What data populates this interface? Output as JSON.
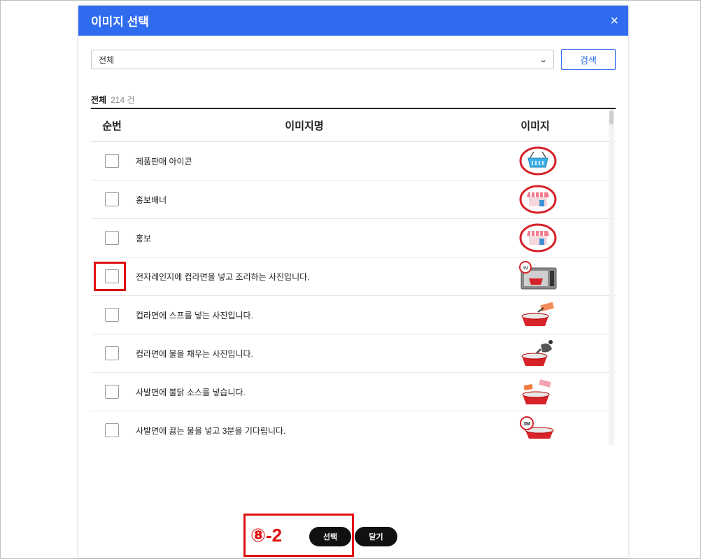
{
  "modal": {
    "title": "이미지 선택",
    "close_icon": "×"
  },
  "filter": {
    "selected": "전체",
    "search_label": "검색"
  },
  "count": {
    "label": "전체",
    "value": "214 건"
  },
  "table": {
    "headers": {
      "no": "순번",
      "name": "이미지명",
      "image": "이미지"
    },
    "rows": [
      {
        "name": "제품판매 아이콘",
        "image_icon": "shopping-basket"
      },
      {
        "name": "홍보배너",
        "image_icon": "storefront"
      },
      {
        "name": "홍보",
        "image_icon": "storefront"
      },
      {
        "name": "전자레인지에 컵라면을 넣고 조리하는 사진입니다.",
        "image_icon": "microwave-3m30s"
      },
      {
        "name": "컵라면에 스프를 넣는 사진입니다.",
        "image_icon": "cup-noodle-soup-packet"
      },
      {
        "name": "컵라면에 물을 채우는 사진입니다.",
        "image_icon": "cup-noodle-kettle"
      },
      {
        "name": "사발면에 불닭 소스를 넣습니다.",
        "image_icon": "bowl-noodle-sauce"
      },
      {
        "name": "사발면에 끓는 물을 넣고 3분을 기다립니다.",
        "image_icon": "bowl-noodle-3m"
      }
    ]
  },
  "footer": {
    "step_label": "⑧-2",
    "select_label": "선택",
    "close_label": "닫기"
  },
  "colors": {
    "header": "#2f6bef",
    "highlight": "#e01010",
    "icon_red": "#d6232a"
  }
}
